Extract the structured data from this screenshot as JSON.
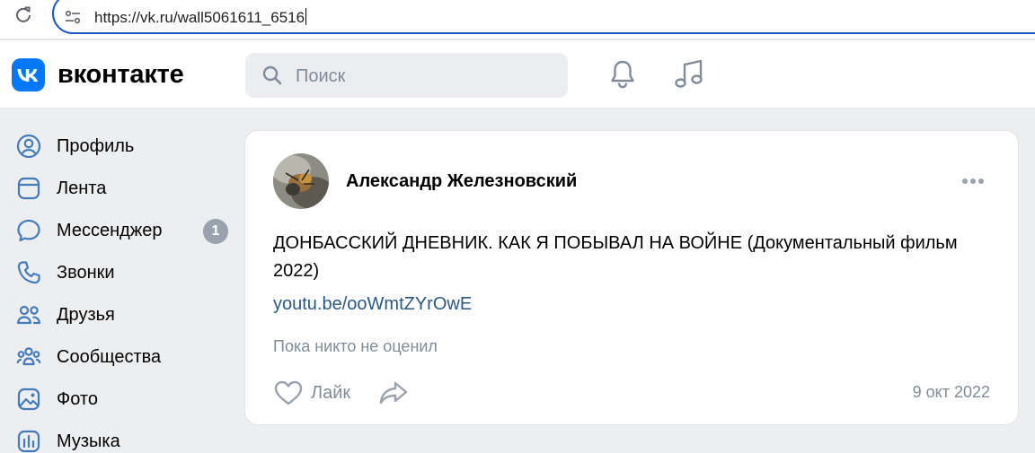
{
  "browser": {
    "url": "https://vk.ru/wall5061611_6516"
  },
  "header": {
    "brand": "вконтакте",
    "search_placeholder": "Поиск"
  },
  "sidebar": {
    "items": [
      {
        "label": "Профиль",
        "icon": "profile-icon"
      },
      {
        "label": "Лента",
        "icon": "feed-icon"
      },
      {
        "label": "Мессенджер",
        "icon": "messenger-icon",
        "badge": "1"
      },
      {
        "label": "Звонки",
        "icon": "phone-icon"
      },
      {
        "label": "Друзья",
        "icon": "friends-icon"
      },
      {
        "label": "Сообщества",
        "icon": "communities-icon"
      },
      {
        "label": "Фото",
        "icon": "photo-icon"
      },
      {
        "label": "Музыка",
        "icon": "music-icon"
      }
    ]
  },
  "post": {
    "author": "Александр Железновский",
    "text": "ДОНБАССКИЙ ДНЕВНИК. КАК Я ПОБЫВАЛ НА ВОЙНЕ (Документальный фильм 2022)",
    "link": "youtu.be/ooWmtZYrOwE",
    "reactions_text": "Пока никто не оценил",
    "like_label": "Лайк",
    "date": "9 окт 2022"
  },
  "colors": {
    "accent": "#0077ff",
    "link": "#2a5885",
    "secondary_text": "#818c99",
    "badge": "#99a2ad",
    "page_bg": "#edeef0"
  }
}
